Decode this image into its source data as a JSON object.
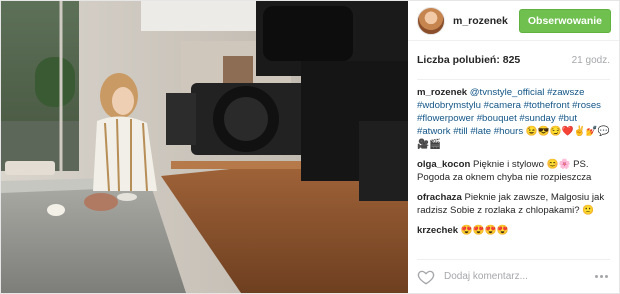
{
  "header": {
    "username": "m_rozenek",
    "follow_label": "Obserwowanie"
  },
  "meta": {
    "likes": "Liczba polubień: 825",
    "time": "21 godz."
  },
  "caption": {
    "username": "m_rozenek",
    "mention": "@tvnstyle_official",
    "hashtags": "#zawsze #wdobrymstylu #camera #tothefront #roses #flowerpower #bouquet #sunday #but #atwork #till #late #hours",
    "emojis": "😉😎😏❤️✌️💅💬🎥🎬"
  },
  "comments": [
    {
      "username": "olga_kocon",
      "text": "Pięknie i stylowo 😊🌸 PS. Pogoda za oknem chyba nie rozpieszcza"
    },
    {
      "username": "ofrachaza",
      "text": "Pieknie jak zawsze, Malgosiu jak radzisz Sobie z rozlaka z chlopakami? 🙁"
    },
    {
      "username": "krzechek",
      "text": "😍😍😍😍"
    }
  ],
  "footer": {
    "comment_placeholder": "Dodaj komentarz..."
  },
  "colors": {
    "follow_button": "#70c050",
    "link": "#125688",
    "muted": "#a5a7aa"
  },
  "icons": {
    "like": "heart-icon",
    "more": "more-options-icon"
  }
}
